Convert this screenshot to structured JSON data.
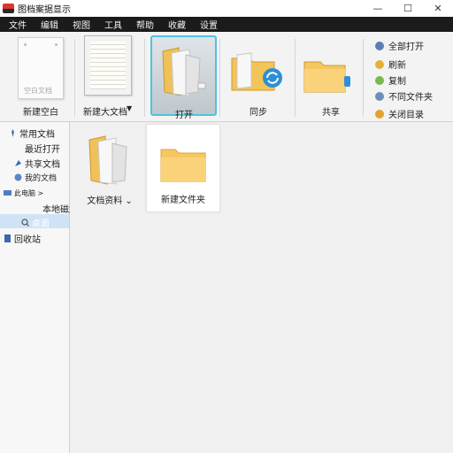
{
  "window": {
    "title": "图档案据显示",
    "controls": {
      "minimize": "—",
      "maximize": "☐",
      "close": "✕"
    }
  },
  "menu": [
    "文件",
    "编辑",
    "视图",
    "工具",
    "帮助",
    "收藏",
    "设置"
  ],
  "ribbon": {
    "tiles": [
      {
        "label": "新建空白",
        "preview_text": "空白文档"
      },
      {
        "label": "新建大文档",
        "dropdown": "▼"
      },
      {
        "label": "打开"
      },
      {
        "label": "同步"
      },
      {
        "label": "共享"
      }
    ],
    "quick_actions": [
      {
        "label": "全部打开",
        "color": "#5a7fb5"
      },
      {
        "label": "刷新",
        "color": "#e3b13a"
      },
      {
        "label": "复制",
        "color": "#7ab850"
      },
      {
        "label": "不同文件夹",
        "color": "#6c8fb8"
      },
      {
        "label": "关闭目录",
        "color": "#e3a32f"
      }
    ]
  },
  "nav": {
    "items": [
      {
        "label": "常用文档",
        "icon": "pin-icon"
      },
      {
        "label": "最近打开"
      },
      {
        "label": "共享文档",
        "icon": "share-icon"
      },
      {
        "label": "我的文档",
        "icon": "user-icon"
      },
      {
        "label": "此电脑 >",
        "icon": "computer-icon"
      },
      {
        "label": "本地磁盘"
      },
      {
        "label": "桌面",
        "icon": "search-icon",
        "selected": true
      },
      {
        "label": "回收站",
        "icon": "recycle-icon"
      }
    ]
  },
  "content": {
    "items": [
      {
        "label": "文档资料 ⌄",
        "type": "open-folder"
      },
      {
        "label": "新建文件夹",
        "type": "folder"
      }
    ]
  },
  "colors": {
    "accent": "#4dc3e0",
    "folder": "#f6c761",
    "menubar": "#1b1b1b"
  }
}
